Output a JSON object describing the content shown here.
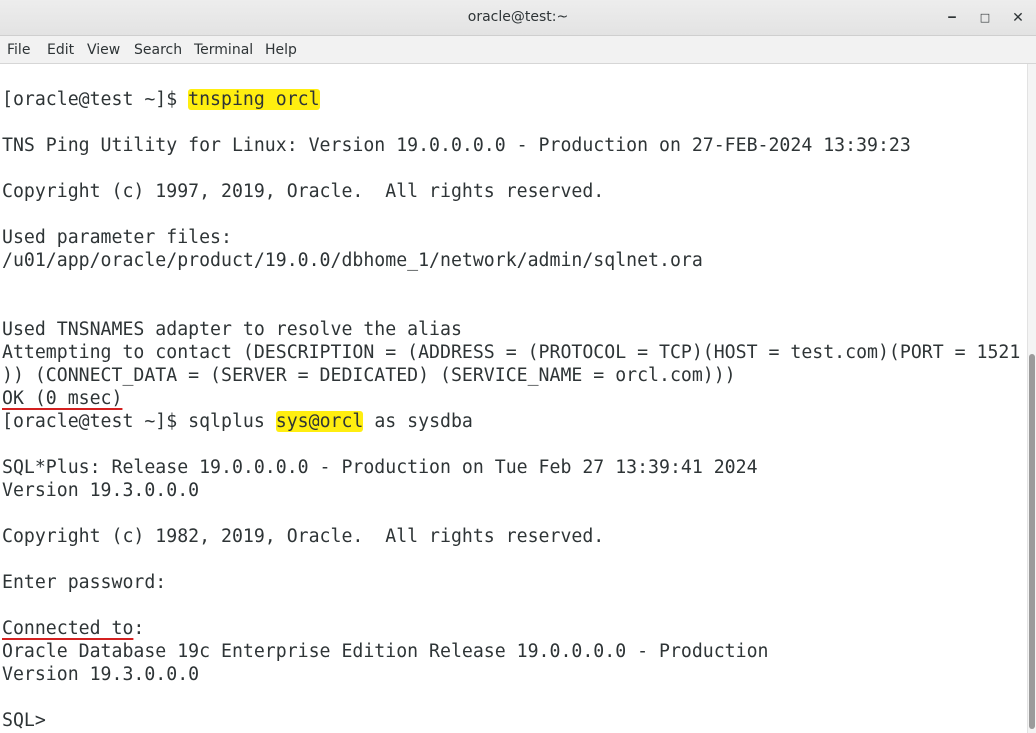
{
  "window": {
    "title": "oracle@test:~",
    "minimize_glyph": "‒",
    "maximize_glyph": "□",
    "close_glyph": "✕"
  },
  "menu": {
    "file": "File",
    "edit": "Edit",
    "view": "View",
    "search": "Search",
    "terminal": "Terminal",
    "help": "Help"
  },
  "terminal": {
    "prompt": "[oracle@test ~]$ ",
    "cmd1": "tnsping orcl",
    "tns_banner": "TNS Ping Utility for Linux: Version 19.0.0.0.0 - Production on 27-FEB-2024 13:39:23",
    "copyright1": "Copyright (c) 1997, 2019, Oracle.  All rights reserved.",
    "used_params": "Used parameter files:",
    "sqlnet_path": "/u01/app/oracle/product/19.0.0/dbhome_1/network/admin/sqlnet.ora",
    "tnsnames_adapter": "Used TNSNAMES adapter to resolve the alias",
    "attempt_line1": "Attempting to contact (DESCRIPTION = (ADDRESS = (PROTOCOL = TCP)(HOST = test.com)(PORT = 1521",
    "attempt_line2": ")) (CONNECT_DATA = (SERVER = DEDICATED) (SERVICE_NAME = orcl.com)))",
    "ok": "OK (0 msec)",
    "cmd2_pre": "sqlplus ",
    "cmd2_highlight": "sys@orcl",
    "cmd2_post": " as sysdba",
    "sqlplus_banner": "SQL*Plus: Release 19.0.0.0.0 - Production on Tue Feb 27 13:39:41 2024",
    "version1": "Version 19.3.0.0.0",
    "copyright2": "Copyright (c) 1982, 2019, Oracle.  All rights reserved.",
    "enter_password": "Enter password:",
    "connected_to": "Connected to",
    "connected_colon": ":",
    "db_edition": "Oracle Database 19c Enterprise Edition Release 19.0.0.0.0 - Production",
    "version2": "Version 19.3.0.0.0",
    "sql_prompt": "SQL> "
  },
  "colors": {
    "highlight": "#ffee10",
    "underline": "#d32020",
    "text": "#2e3436"
  }
}
